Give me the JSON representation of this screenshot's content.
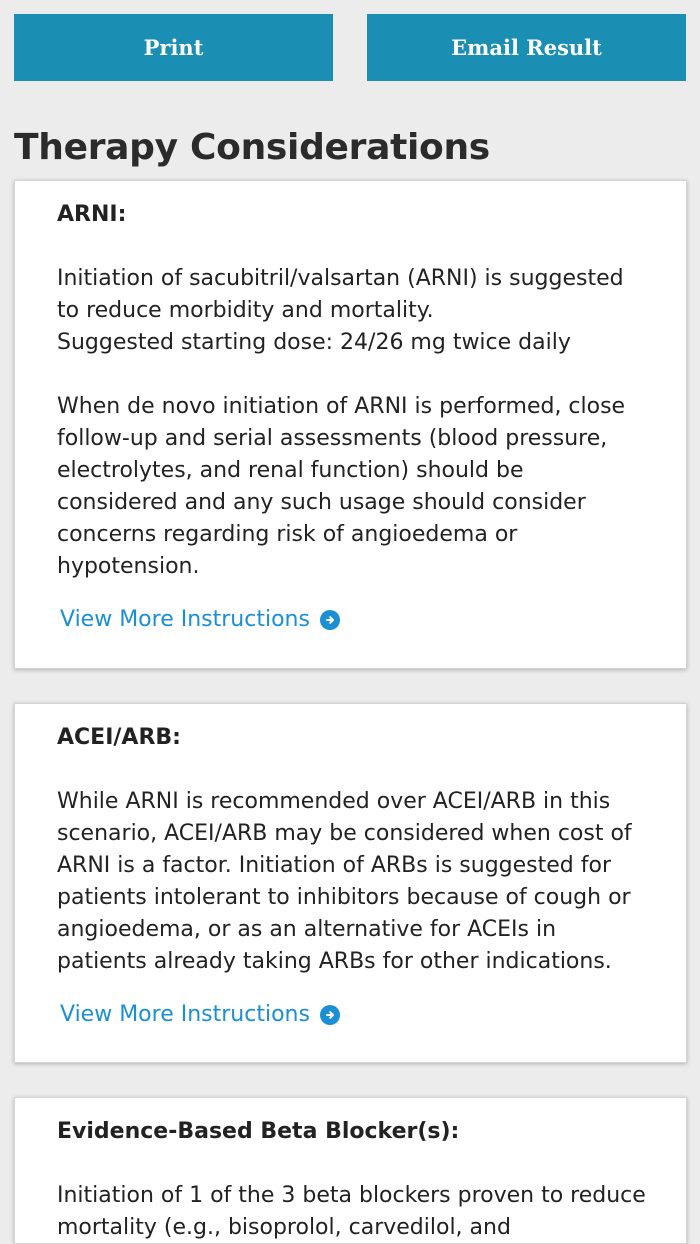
{
  "toolbar": {
    "print_label": "Print",
    "email_label": "Email Result"
  },
  "page": {
    "title": "Therapy Considerations"
  },
  "cards": [
    {
      "title": "ARNI:",
      "p1_line1": "Initiation of sacubitril/valsartan (ARNI) is suggested",
      "p1_line2": "to reduce morbidity and mortality.",
      "p1_line3": "Suggested starting dose: 24/26 mg twice daily",
      "p2": "When de novo initiation of ARNI is performed, close follow-up and serial assessments (blood pressure, electrolytes, and renal function) should be considered and any such usage should consider concerns regarding risk of angioedema or hypotension.",
      "link": "View More Instructions"
    },
    {
      "title": "ACEI/ARB:",
      "p1": "While ARNI is recommended over ACEI/ARB in this scenario, ACEI/ARB may be considered when cost of ARNI is a factor. Initiation of ARBs is suggested for patients intolerant to inhibitors because of cough or angioedema, or as an alternative for ACEIs in patients already taking ARBs for other indications.",
      "link": "View More Instructions"
    },
    {
      "title": "Evidence-Based Beta Blocker(s):",
      "p1": "Initiation of 1 of the 3 beta blockers proven to reduce mortality (e.g., bisoprolol, carvedilol, and"
    }
  ],
  "icons": {
    "link_arrow": "circle-arrow-right-icon"
  },
  "colors": {
    "button_bg": "#1a8fb3",
    "link": "#1a8fd3",
    "background": "#ececec"
  }
}
